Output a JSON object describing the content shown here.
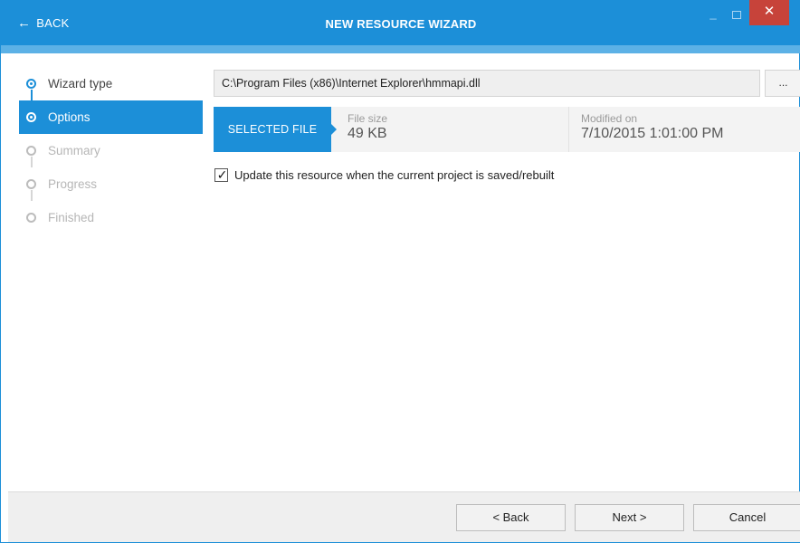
{
  "window": {
    "back_label": "BACK",
    "back_icon": "left-arrow-icon",
    "title": "NEW RESOURCE WIZARD",
    "minimize_icon": "minimize-icon",
    "maximize_icon": "maximize-icon",
    "close_icon": "close-icon",
    "close_glyph": "✕",
    "accent_color": "#1c8fd8",
    "close_color": "#c7433a"
  },
  "sidebar": {
    "steps": [
      {
        "label": "Wizard type",
        "state": "completed"
      },
      {
        "label": "Options",
        "state": "active"
      },
      {
        "label": "Summary",
        "state": "disabled"
      },
      {
        "label": "Progress",
        "state": "disabled"
      },
      {
        "label": "Finished",
        "state": "disabled"
      }
    ]
  },
  "file": {
    "path": "C:\\Program Files (x86)\\Internet Explorer\\hmmapi.dll",
    "browse_label": "...",
    "selected_label": "SELECTED FILE",
    "size_label": "File size",
    "size_value": "49 KB",
    "modified_label": "Modified on",
    "modified_value": "7/10/2015 1:01:00 PM"
  },
  "options": {
    "update_checkbox_label": "Update this resource when the current project is saved/rebuilt",
    "update_checked": true
  },
  "footer": {
    "back_button": "< Back",
    "next_button": "Next >",
    "cancel_button": "Cancel"
  }
}
